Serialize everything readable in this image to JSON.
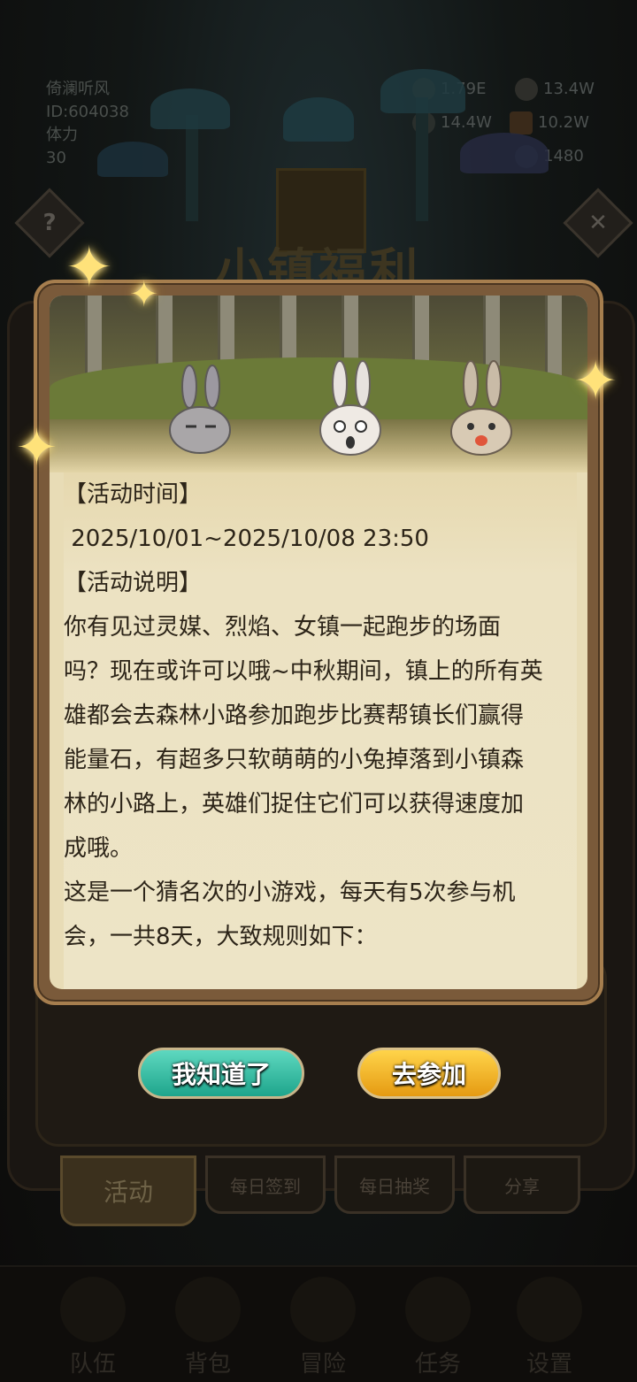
{
  "profile": {
    "name": "倚澜听风",
    "id": "ID:604038",
    "stamina_label": "体力",
    "stamina_value": "30"
  },
  "resources": [
    {
      "icon": "coin-icon",
      "value": "1.79E"
    },
    {
      "icon": "wand-icon",
      "value": "13.4W"
    },
    {
      "icon": "gear-icon",
      "value": "14.4W"
    },
    {
      "icon": "box-icon",
      "value": "10.2W"
    },
    {
      "icon": "gem-icon",
      "value": "1480"
    }
  ],
  "header": {
    "title": "小镇福利",
    "help_icon": "?"
  },
  "dialog": {
    "section1_title": "【活动时间】",
    "period": " 2025/10/01~2025/10/08 23:50",
    "section2_title": "【活动说明】",
    "body_lines": [
      "你有见过灵媒、烈焰、女镇一起跑步的场面",
      "吗？现在或许可以哦~中秋期间，镇上的所有英",
      "雄都会去森林小路参加跑步比赛帮镇长们赢得",
      "能量石，有超多只软萌萌的小兔掉落到小镇森",
      "林的小路上，英雄们捉住它们可以获得速度加",
      "成哦。",
      "",
      "这是一个猜名次的小游戏，每天有5次参与机",
      "会，一共8天，大致规则如下："
    ]
  },
  "buttons": {
    "ok": "我知道了",
    "join": "去参加"
  },
  "tabs": [
    "活动",
    "每日签到",
    "每日抽奖",
    "分享"
  ],
  "bottom_nav": [
    "队伍",
    "背包",
    "冒险",
    "任务",
    "设置"
  ],
  "colors": {
    "ok_button": "#2fb89e",
    "join_button": "#f2b52a",
    "dialog_frame": "#a67e4e",
    "dialog_paper": "#ede4c6"
  }
}
